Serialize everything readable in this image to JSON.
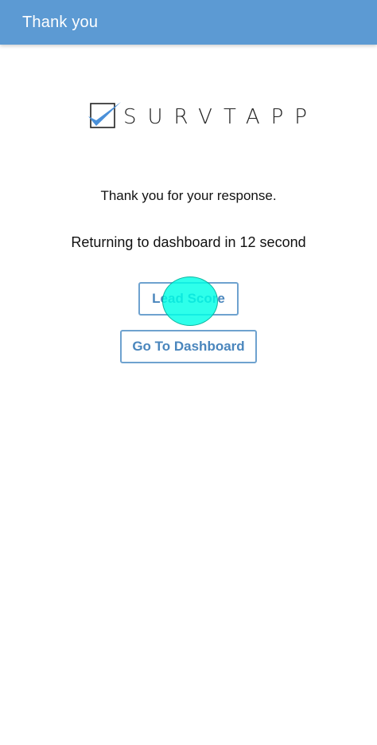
{
  "app_bar": {
    "title": "Thank you",
    "color": "#5c9ad3"
  },
  "logo": {
    "text": "SURVTAPP",
    "icon": "checkbox-check-icon",
    "accent_color": "#4a90d9"
  },
  "message": {
    "thanks": "Thank you for your response.",
    "returning": "Returning to dashboard in 12 second"
  },
  "buttons": {
    "lead_score": "Lead Score",
    "go_to_dashboard": "Go To Dashboard",
    "border_color": "#6ea2cf",
    "text_color": "#4a86bd"
  },
  "touch_indicator_color": "#00ffe5"
}
